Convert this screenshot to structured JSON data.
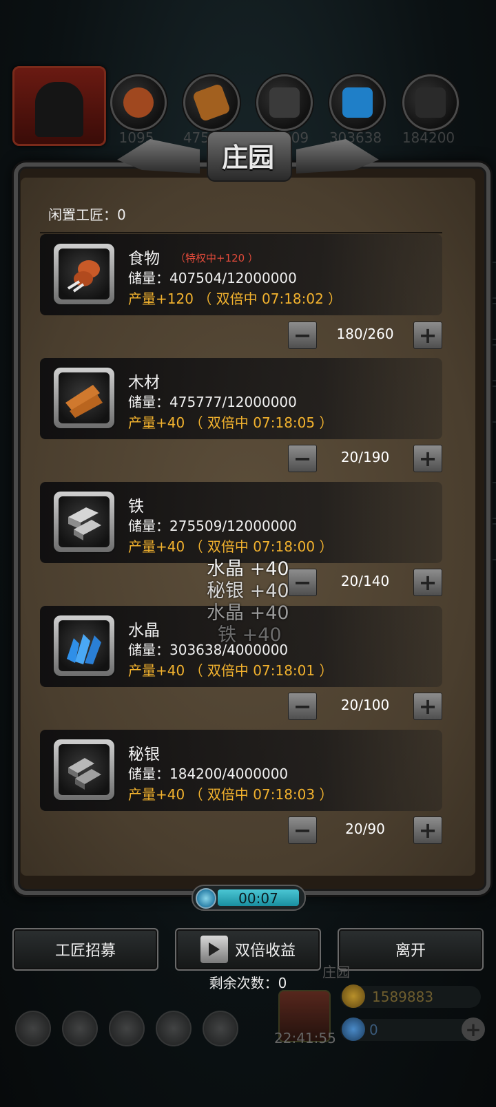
{
  "title": "庄园",
  "idle_artisans": "闲置工匠：0",
  "background": {
    "resource_numbers": [
      "1095",
      "475777",
      "275509",
      "303638",
      "184200"
    ],
    "manor_label": "庄园",
    "gold": "1589883",
    "gems": "0",
    "clock": "22:41:55"
  },
  "resources": [
    {
      "name": "食物",
      "badge": "（特权中+120 ）",
      "storage": "储量：407504/12000000",
      "production": "产量+120 （ 双倍中 07:18:02 ）",
      "stepper": "180/260",
      "color": "#c85a28",
      "icon": "food-icon"
    },
    {
      "name": "木材",
      "badge": "",
      "storage": "储量：475777/12000000",
      "production": "产量+40 （ 双倍中 07:18:05 ）",
      "stepper": "20/190",
      "color": "#d0792e",
      "icon": "wood-icon"
    },
    {
      "name": "铁",
      "badge": "",
      "storage": "储量：275509/12000000",
      "production": "产量+40 （ 双倍中 07:18:00 ）",
      "stepper": "20/140",
      "color": "#bdbdbd",
      "icon": "iron-icon"
    },
    {
      "name": "水晶",
      "badge": "",
      "storage": "储量：303638/4000000",
      "production": "产量+40 （ 双倍中 07:18:01 ）",
      "stepper": "20/100",
      "color": "#2f8fe8",
      "icon": "crystal-icon"
    },
    {
      "name": "秘银",
      "badge": "",
      "storage": "储量：184200/4000000",
      "production": "产量+40 （ 双倍中 07:18:03 ）",
      "stepper": "20/90",
      "color": "#9a9a9a",
      "icon": "mithril-icon"
    }
  ],
  "floating_texts": [
    "水晶 +40",
    "秘银 +40",
    "水晶 +40",
    "铁 +40"
  ],
  "timer": "00:07",
  "buttons": {
    "recruit": "工匠招募",
    "double": "双倍收益",
    "leave": "离开"
  },
  "remaining": "剩余次数：0",
  "stepper_minus": "−",
  "stepper_plus": "+"
}
